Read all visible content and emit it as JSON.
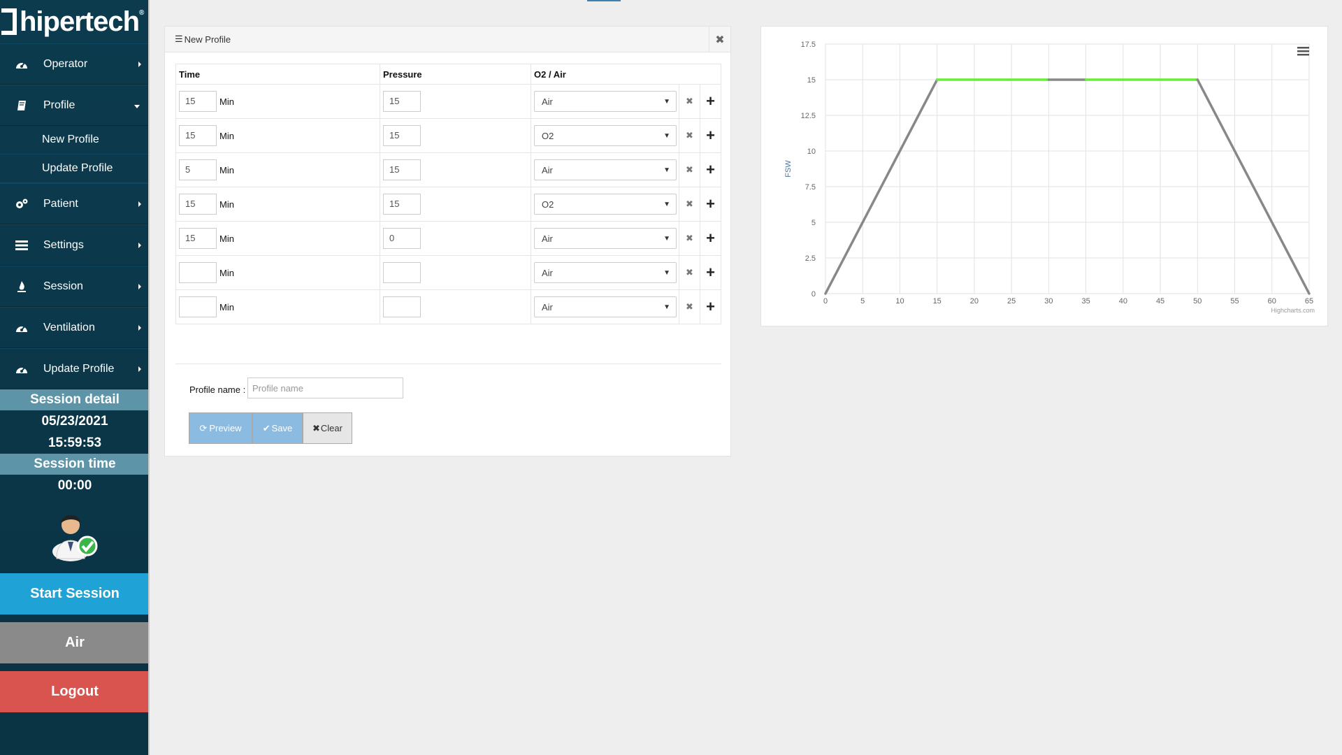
{
  "app": {
    "logo_text": "hipertech",
    "logo_mark": "®"
  },
  "sidebar": {
    "items": [
      {
        "label": "Operator",
        "icon": "dashboard-icon"
      },
      {
        "label": "Profile",
        "icon": "book-icon"
      },
      {
        "label": "Patient",
        "icon": "gears-icon"
      },
      {
        "label": "Settings",
        "icon": "list-icon"
      },
      {
        "label": "Session",
        "icon": "fire-icon"
      },
      {
        "label": "Ventilation",
        "icon": "dashboard-icon"
      },
      {
        "label": "Update Profile",
        "icon": "dashboard-icon"
      }
    ],
    "profile_sub": [
      "New Profile",
      "Update Profile"
    ],
    "session_detail_title": "Session detail",
    "session_date": "05/23/2021",
    "session_clock": "15:59:53",
    "session_time_title": "Session time",
    "session_time": "00:00",
    "start_session": "Start Session",
    "gas_mode": "Air",
    "logout": "Logout",
    "colors": {
      "start": "#1fa3d6",
      "air": "#8a8a8a",
      "logout": "#d9534f"
    }
  },
  "panel": {
    "title": "New Profile",
    "columns": [
      "Time",
      "Pressure",
      "O2 / Air"
    ],
    "unit": "Min",
    "rows": [
      {
        "time": "15",
        "pressure": "15",
        "gas": "Air"
      },
      {
        "time": "15",
        "pressure": "15",
        "gas": "O2"
      },
      {
        "time": "5",
        "pressure": "15",
        "gas": "Air"
      },
      {
        "time": "15",
        "pressure": "15",
        "gas": "O2"
      },
      {
        "time": "15",
        "pressure": "0",
        "gas": "Air"
      },
      {
        "time": "",
        "pressure": "",
        "gas": "Air"
      },
      {
        "time": "",
        "pressure": "",
        "gas": "Air"
      }
    ],
    "profile_name_label": "Profile name :",
    "profile_name_placeholder": "Profile name",
    "buttons": {
      "preview": "Preview",
      "save": "Save",
      "clear": "Clear"
    }
  },
  "chart_data": {
    "type": "line",
    "title": "",
    "xlabel": "",
    "ylabel": "FSW",
    "xlim": [
      0,
      65
    ],
    "ylim": [
      0,
      17.5
    ],
    "x_ticks": [
      0,
      5,
      10,
      15,
      20,
      25,
      30,
      35,
      40,
      45,
      50,
      55,
      60,
      65
    ],
    "y_ticks": [
      0,
      2.5,
      5,
      7.5,
      10,
      12.5,
      15,
      17.5
    ],
    "grid": true,
    "credit": "Highcharts.com",
    "segments": [
      {
        "x": [
          0,
          15
        ],
        "y": [
          0,
          15
        ],
        "color": "#888888"
      },
      {
        "x": [
          15,
          30
        ],
        "y": [
          15,
          15
        ],
        "color": "#66ee33"
      },
      {
        "x": [
          30,
          35
        ],
        "y": [
          15,
          15
        ],
        "color": "#888888"
      },
      {
        "x": [
          35,
          50
        ],
        "y": [
          15,
          15
        ],
        "color": "#66ee33"
      },
      {
        "x": [
          50,
          65
        ],
        "y": [
          15,
          0
        ],
        "color": "#888888"
      }
    ]
  }
}
